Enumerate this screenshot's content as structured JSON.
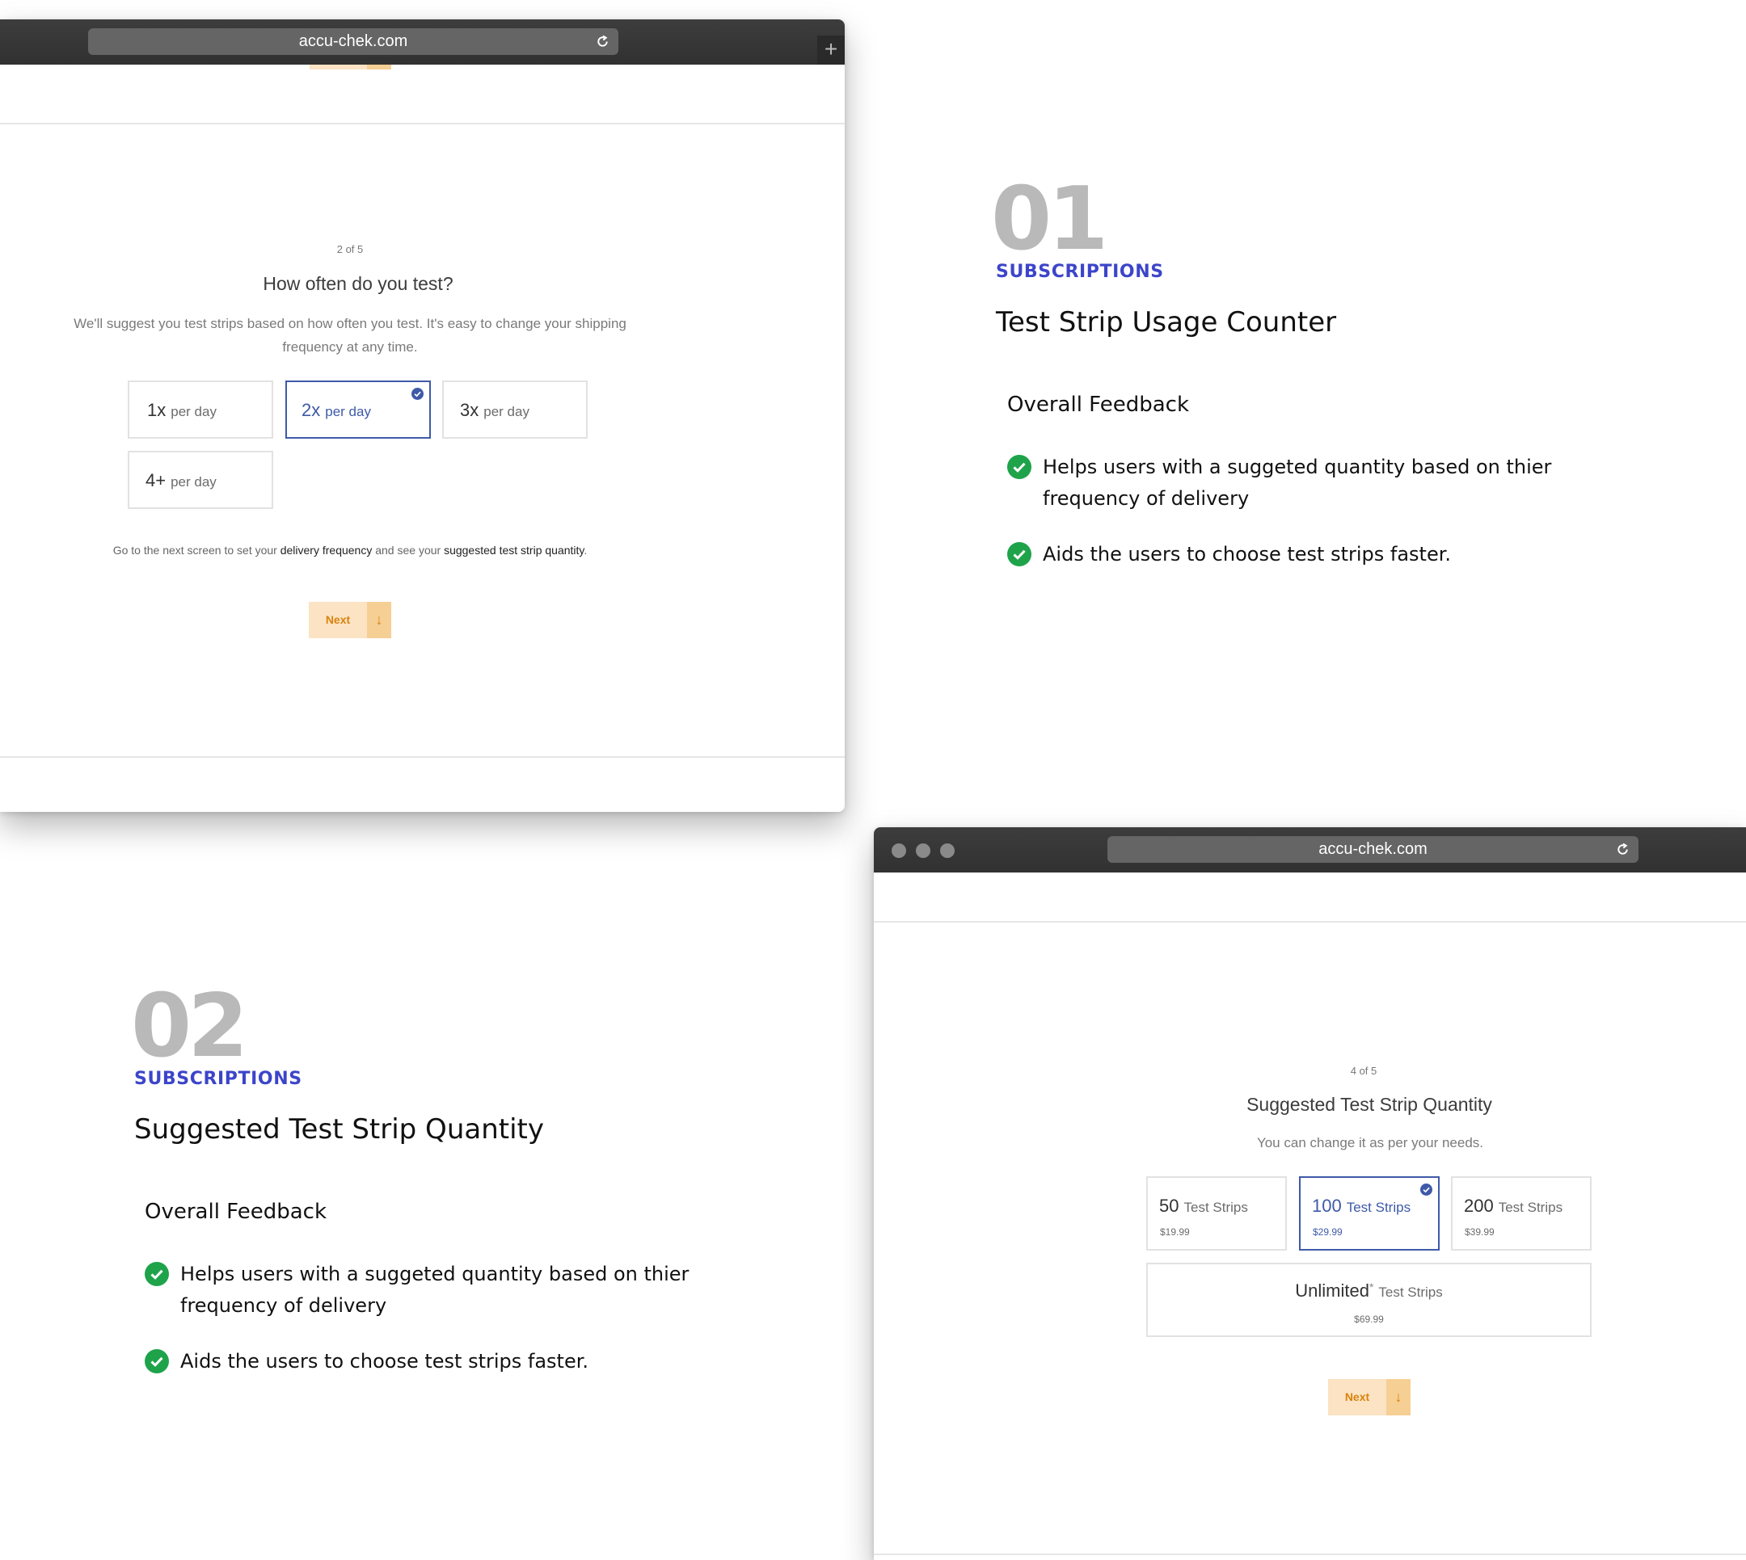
{
  "colors": {
    "accent_blue": "#3c45c9",
    "selected_blue": "#3e5aa8",
    "next_bg": "#fbe3c3",
    "next_text": "#d9830e",
    "check_green": "#1fa34a"
  },
  "window1": {
    "url": "accu-chek.com",
    "step": "2 of 5",
    "question": "How often do you test?",
    "description_line1": "We'll suggest you test strips based on how often you test. It's easy to change your shipping",
    "description_line2": "frequency at any time.",
    "options": [
      {
        "num": "1x",
        "unit": "per day",
        "selected": false
      },
      {
        "num": "2x",
        "unit": "per day",
        "selected": true
      },
      {
        "num": "3x",
        "unit": "per day",
        "selected": false
      },
      {
        "num": "4+",
        "unit": "per day",
        "selected": false
      }
    ],
    "hint": {
      "prefix": "Go to the next screen to set your ",
      "link1": "delivery frequency",
      "middle": " and see your ",
      "link2": "suggested test strip quantity",
      "suffix": "."
    },
    "next_label": "Next",
    "next_arrow": "↓"
  },
  "section1": {
    "number": "01",
    "label": "SUBSCRIPTIONS",
    "title": "Test Strip Usage Counter",
    "feedback_title": "Overall Feedback",
    "items": [
      {
        "line1": "Helps users with a suggeted quantity based on thier",
        "line2": "frequency of delivery"
      },
      {
        "line1": "Aids the users to choose test strips faster.",
        "line2": ""
      }
    ]
  },
  "section2": {
    "number": "02",
    "label": "SUBSCRIPTIONS",
    "title": "Suggested Test Strip Quantity",
    "feedback_title": "Overall Feedback",
    "items": [
      {
        "line1": "Helps users with a suggeted quantity based on thier",
        "line2": "frequency of delivery"
      },
      {
        "line1": "Aids the users to choose test strips faster.",
        "line2": ""
      }
    ]
  },
  "window2": {
    "url": "accu-chek.com",
    "step": "4 of 5",
    "title": "Suggested Test Strip Quantity",
    "description": "You can change it as per your needs.",
    "options": [
      {
        "num": "50",
        "unit": "Test Strips",
        "price": "$19.99",
        "selected": false
      },
      {
        "num": "100",
        "unit": "Test Strips",
        "price": "$29.99",
        "selected": true
      },
      {
        "num": "200",
        "unit": "Test Strips",
        "price": "$39.99",
        "selected": false
      }
    ],
    "unlimited": {
      "num": "Unlimited",
      "asterisk": "*",
      "unit": "Test Strips",
      "price": "$69.99"
    },
    "next_label": "Next",
    "next_arrow": "↓"
  }
}
